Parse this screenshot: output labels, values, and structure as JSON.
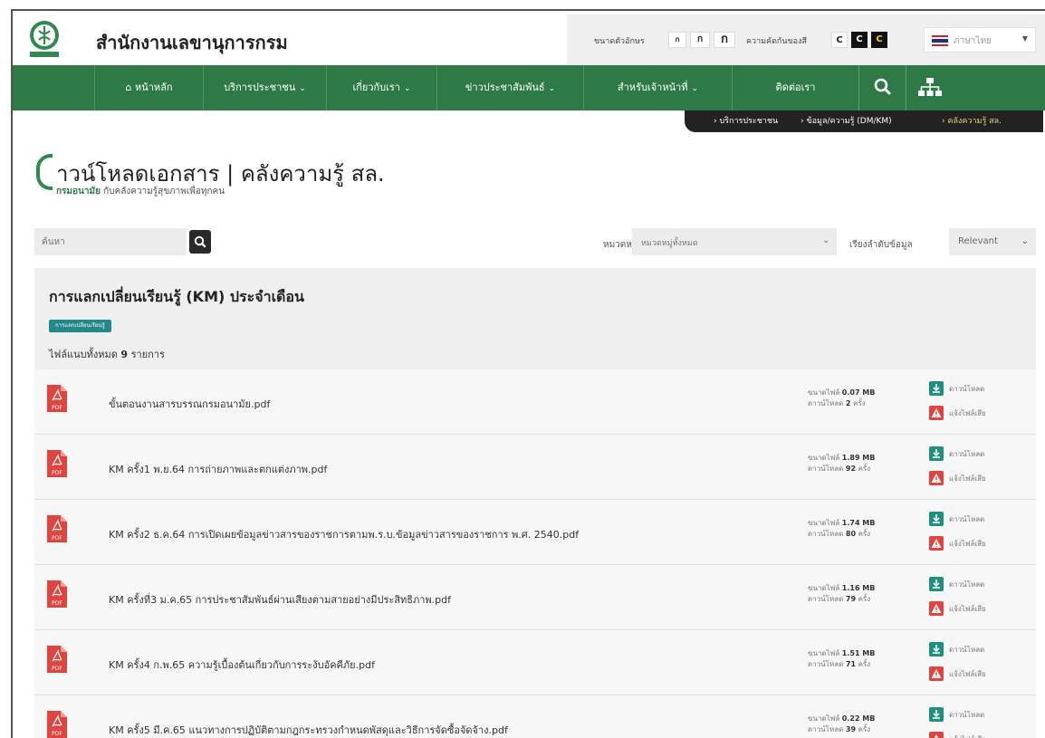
{
  "header": {
    "site_title": "สำนักงานเลขานุการกรม",
    "font_size_label": "ขนาดตัวอักษร",
    "font_size_options": [
      "ก",
      "ก",
      "ก"
    ],
    "contrast_label": "ความคัดกันของสี",
    "contrast_options": [
      "C",
      "C",
      "C"
    ],
    "language": "ภาษาไทย"
  },
  "nav": {
    "home": "หน้าหลัก",
    "services": "บริการประชาชน",
    "about": "เกี่ยวกับเรา",
    "news": "ข่าวประชาสัมพันธ์",
    "staff": "สำหรับเจ้าหน้าที่",
    "contact": "ติดต่อเรา"
  },
  "breadcrumb": [
    "บริการประชาชน",
    "ข้อมูล/ความรู้ (DM/KM)",
    "คลังความรู้ สล."
  ],
  "page": {
    "title": "าวน์โหลดเอกสาร | คลังความรู้ สล.",
    "subtitle_bold": "กรมอนามัย",
    "subtitle_rest": " กับคลังความรู้สุขภาพเพื่อทุกคน"
  },
  "search": {
    "placeholder": "ค้นหา"
  },
  "filter": {
    "label": "หมวดหมู่",
    "value": "หมวดหมู่ทั้งหมด",
    "sort_label": "เรียงลำดับข้อมูล",
    "sort_value": "Relevant"
  },
  "panel": {
    "title": "การแลกเปลี่ยนเรียนรู้ (KM) ประจำเดือน",
    "tag": "การแลกเปลี่ยนเรียนรู้",
    "count_prefix": "ไฟล์แนบทั้งหมด",
    "count": "9",
    "count_suffix": "รายการ"
  },
  "labels": {
    "size_prefix": "ขนาดไฟล์",
    "downloads_prefix": "ดาวน์โหลด",
    "times": "ครั้ง",
    "download_action": "ดาวน์โหลด",
    "report_action": "แจ้งไฟล์เสีย",
    "pdf": "PDF"
  },
  "files": [
    {
      "name": "ขั้นตอนงานสารบรรณกรมอนามัย.pdf",
      "size": "0.07 MB",
      "downloads": "2"
    },
    {
      "name": "KM ครั้ง1 พ.ย.64 การถ่ายภาพและตกแต่งภาพ.pdf",
      "size": "1.89 MB",
      "downloads": "92"
    },
    {
      "name": "KM ครั้ง2 ธ.ค.64 การเปิดเผยข้อมูลข่าวสารของราชการตามพ.ร.บ.ข้อมูลข่าวสารของราชการ พ.ศ. 2540.pdf",
      "size": "1.74 MB",
      "downloads": "80"
    },
    {
      "name": "KM ครั้งที่3 ม.ค.65 การประชาสัมพันธ์ผ่านเสียงตามสายอย่างมีประสิทธิภาพ.pdf",
      "size": "1.16 MB",
      "downloads": "79"
    },
    {
      "name": "KM ครั้ง4 ก.พ.65 ความรู้เบื้องต้นเกี่ยวกับการระงับอัคคีภัย.pdf",
      "size": "1.51 MB",
      "downloads": "71"
    },
    {
      "name": "KM ครั้ง5 มี.ค.65 แนวทางการปฏิบัติตามกฎกระทรวงกำหนดพัสดุและวิธีการจัดซื้อจัดจ้าง.pdf",
      "size": "0.22 MB",
      "downloads": "39"
    }
  ],
  "colors": {
    "nav_green": "#2e7a47",
    "tag_teal": "#23888a",
    "pdf_red": "#e0443e",
    "download_teal": "#1f8f7f",
    "report_red": "#e0443e"
  }
}
